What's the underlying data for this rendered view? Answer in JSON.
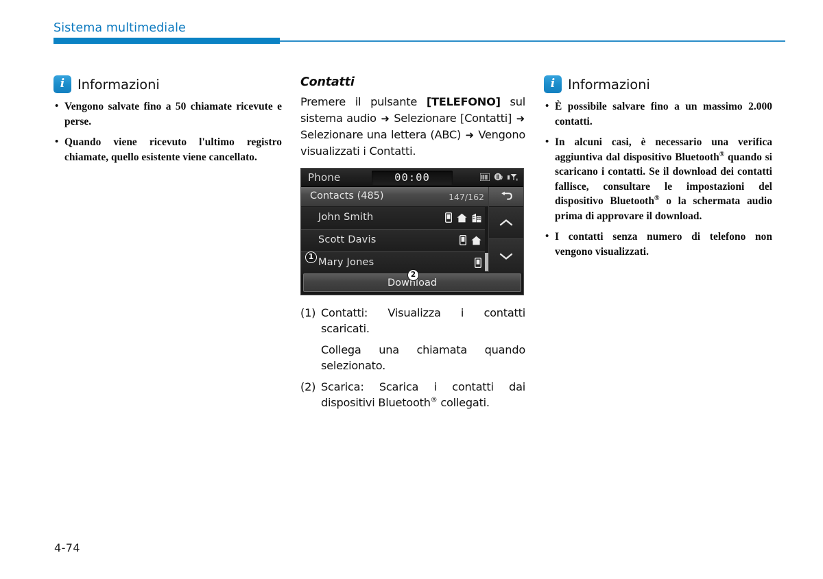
{
  "header": {
    "title": "Sistema multimediale",
    "accent_color": "#0b82c4"
  },
  "footer": {
    "page_number": "4-74"
  },
  "left_column": {
    "info_box": {
      "badge": "i",
      "title": "Informazioni",
      "items": [
        "Vengono salvate fino a 50 chiamate ricevute e perse.",
        "Quando viene ricevuto l'ultimo registro chiamate, quello esistente viene cancellato."
      ]
    }
  },
  "middle_column": {
    "section_title": "Contatti",
    "intro_part1": "Premere il pulsante ",
    "intro_bold": "[TELEFONO]",
    "intro_part2": " sul sistema audio ",
    "arrow": "➜",
    "intro_part3": " Selezionare [Contatti] ",
    "intro_part4": " Selezionare una lettera (ABC) ",
    "intro_part5": " Vengono visualizzati i Contatti.",
    "device": {
      "screen_name": "Phone",
      "clock": "00:00",
      "status_icons": [
        "equalizer-icon",
        "mute-sound-icon",
        "antenna-signal-icon"
      ],
      "list_header": {
        "label": "Contacts (485)",
        "counter": "147/162"
      },
      "contacts": [
        {
          "name": "John Smith",
          "icons": [
            "mobile-icon",
            "home-icon",
            "office-icon"
          ]
        },
        {
          "name": "Scott Davis",
          "icons": [
            "mobile-icon",
            "home-icon"
          ]
        },
        {
          "name": "Mary Jones",
          "icons": [
            "mobile-icon"
          ]
        }
      ],
      "rail": {
        "back": "back-arrow-icon",
        "up": "chevron-up-icon",
        "down": "chevron-down-icon"
      },
      "download_label": "Download",
      "markers": {
        "one": "1",
        "two": "2"
      }
    },
    "captions": [
      {
        "num": "(1)",
        "text": "Contatti: Visualizza i contatti scaricati.",
        "sub": "Collega una chiamata quando selezionato."
      },
      {
        "num": "(2)",
        "text_a": "Scarica: Scarica i contatti dai dispositivi Bluetooth",
        "sup": "®",
        "text_b": " collegati."
      }
    ]
  },
  "right_column": {
    "info_box": {
      "badge": "i",
      "title": "Informazioni",
      "items": [
        {
          "text": "È possibile salvare fino a un massimo 2.000 contatti."
        },
        {
          "text_a": "In alcuni casi, è necessario una verifica aggiuntiva dal dispositivo Bluetooth",
          "sup1": "®",
          "text_b": " quando si scaricano i contatti. Se il download dei contatti fallisce, consultare le impostazioni del dispositivo Bluetooth",
          "sup2": "®",
          "text_c": " o la schermata audio prima di approvare il download."
        },
        {
          "text": "I contatti senza numero di telefono non vengono visualizzati."
        }
      ]
    }
  }
}
